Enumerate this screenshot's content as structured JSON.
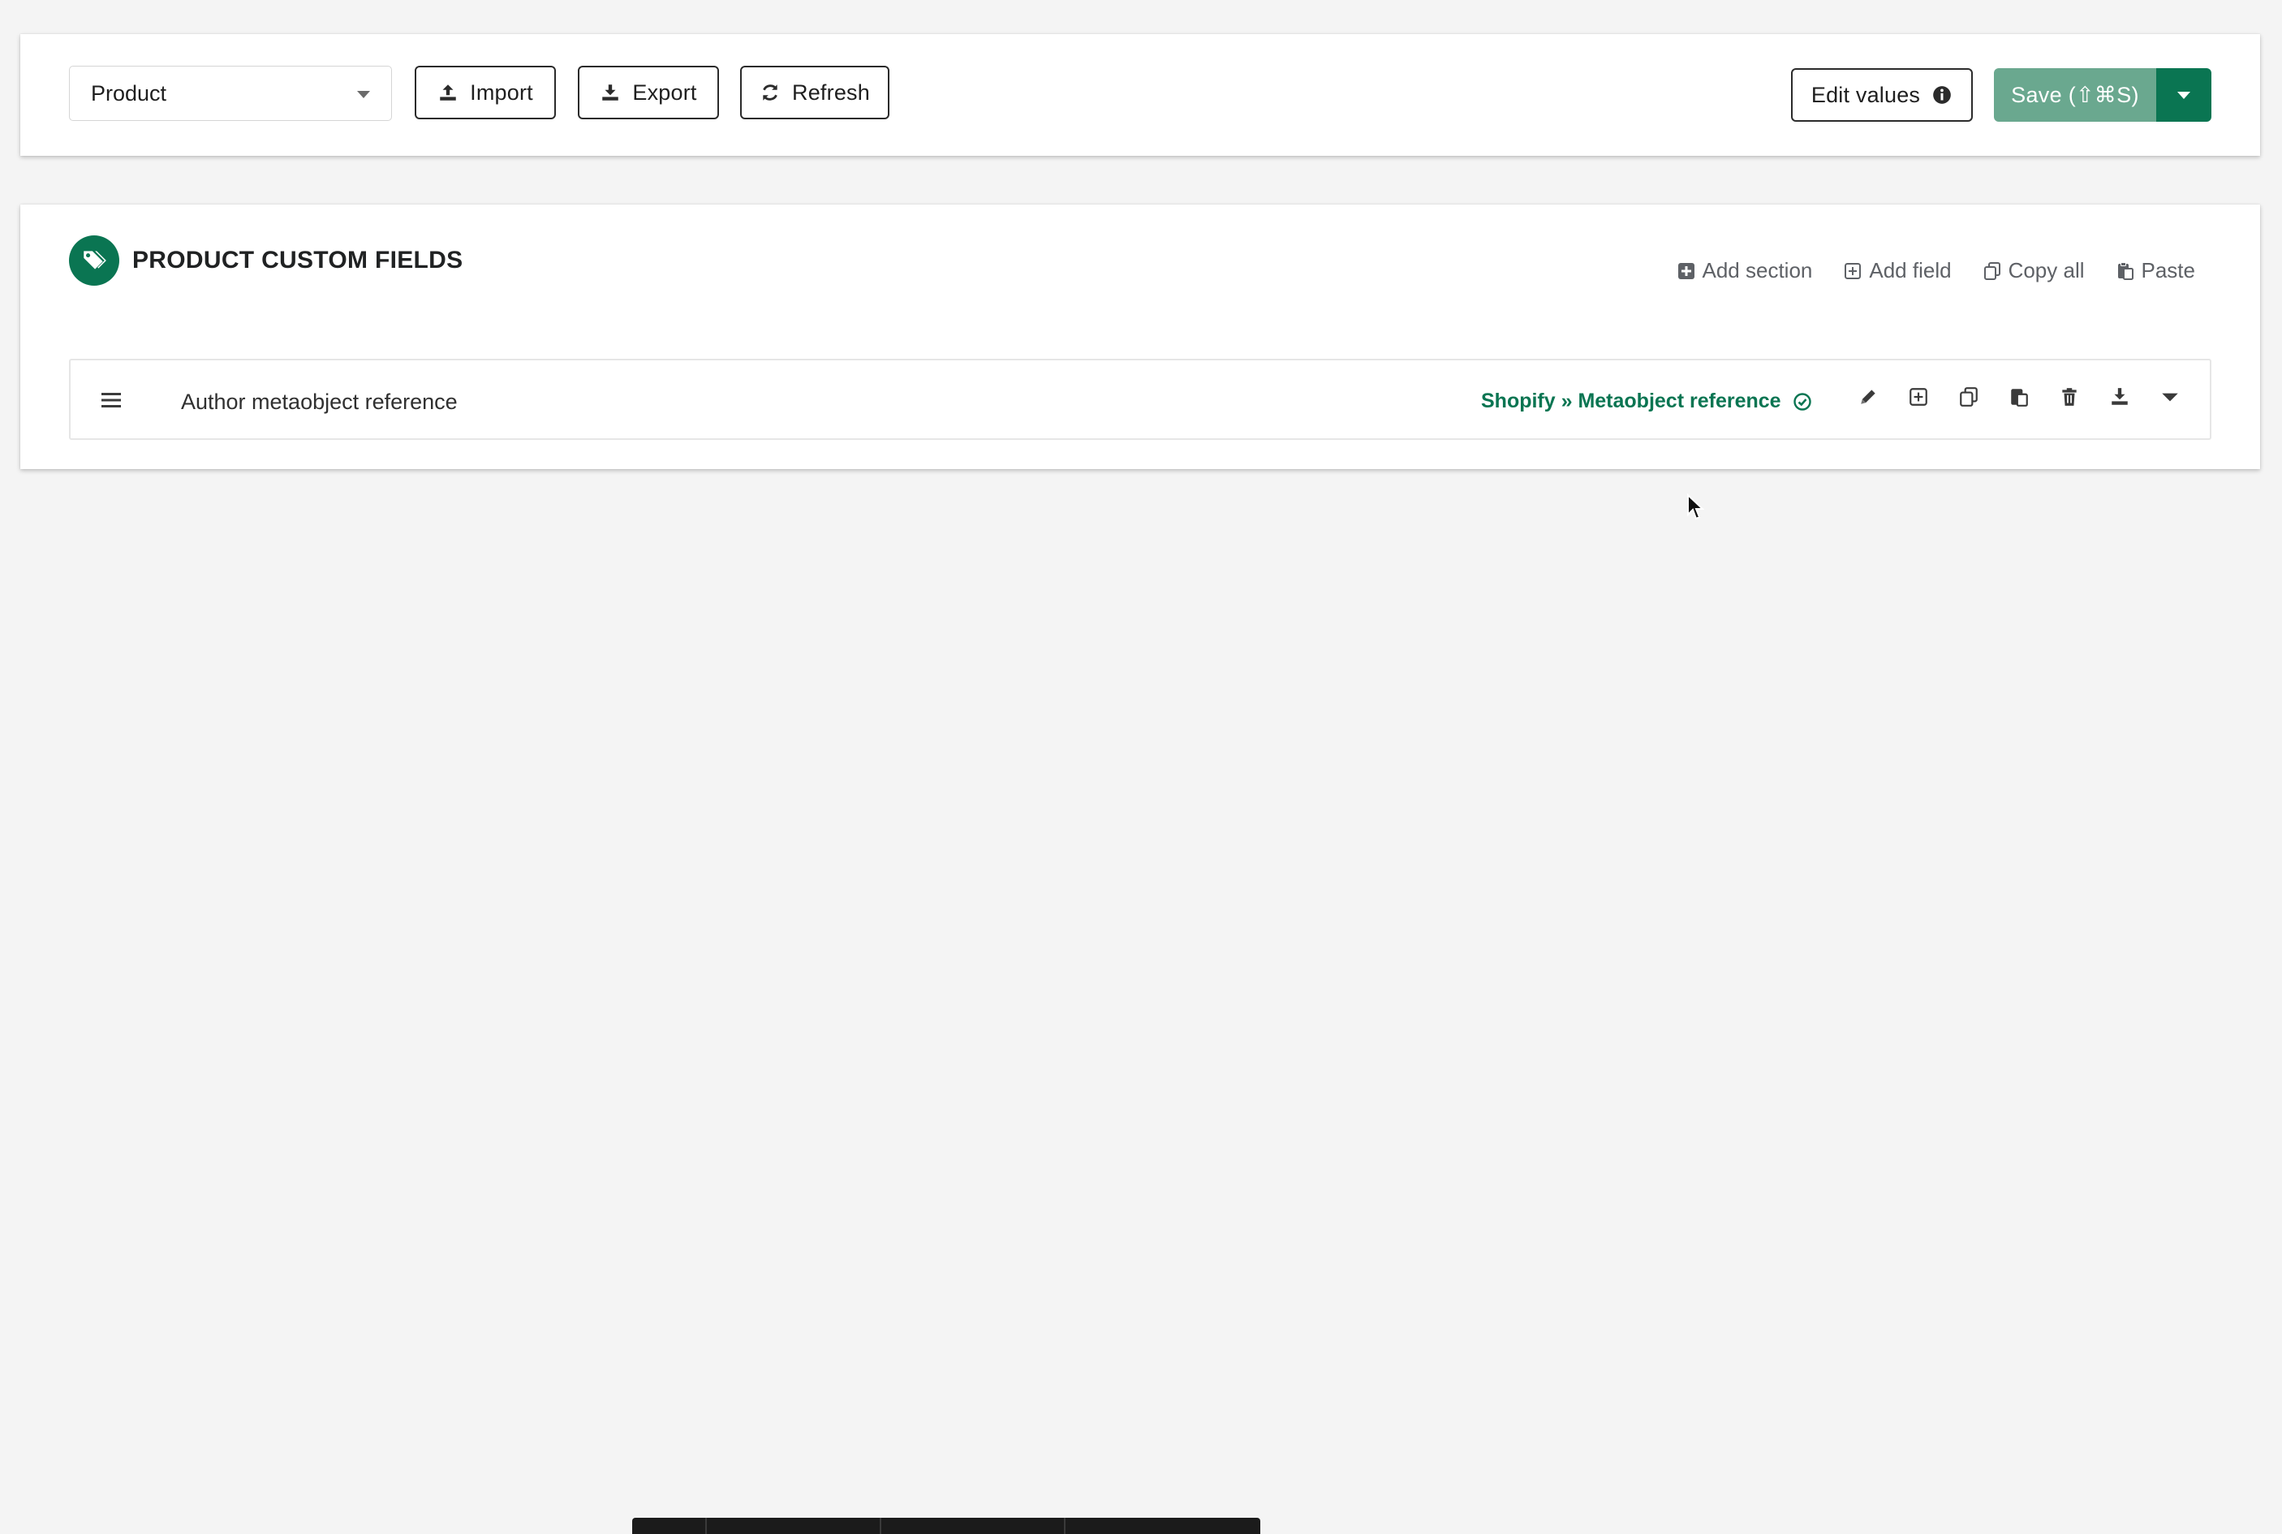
{
  "toolbar": {
    "resource_select": "Product",
    "import_label": "Import",
    "export_label": "Export",
    "refresh_label": "Refresh",
    "edit_values_label": "Edit values",
    "save_label": "Save (⇧⌘S)"
  },
  "section": {
    "title": "PRODUCT CUSTOM FIELDS",
    "actions": {
      "add_section": "Add section",
      "add_field": "Add field",
      "copy_all": "Copy all",
      "paste": "Paste"
    }
  },
  "fields": [
    {
      "name": "Author metaobject reference",
      "type_label": "Shopify » Metaobject reference"
    }
  ],
  "colors": {
    "brand_green": "#0a7552",
    "save_green": "#6aa88f",
    "background": "#f4f4f4"
  },
  "icons": [
    "upload-icon",
    "download-icon",
    "refresh-icon",
    "info-icon",
    "tags-icon",
    "plus-square-icon",
    "copy-icon",
    "paste-icon",
    "drag-handle-icon",
    "check-circle-icon",
    "pencil-icon",
    "trash-icon",
    "chevron-down-icon"
  ]
}
